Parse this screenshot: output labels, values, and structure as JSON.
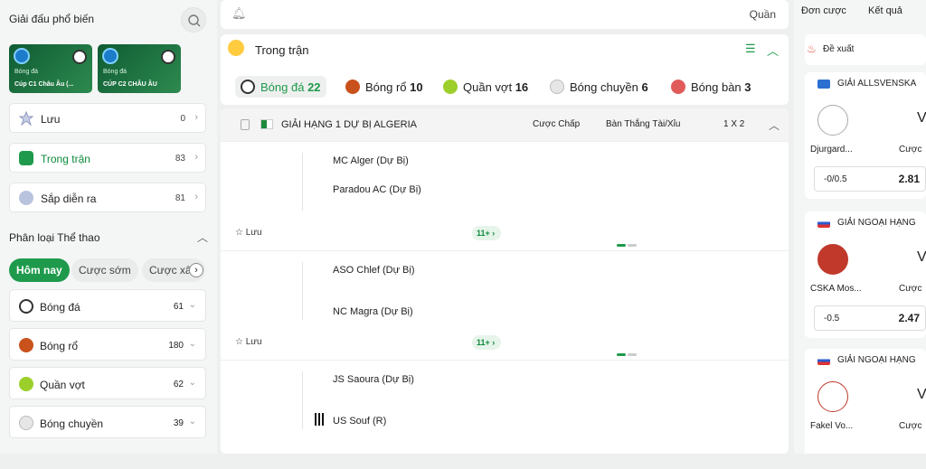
{
  "left": {
    "title": "Giải đấu phổ biến",
    "cards": [
      {
        "t1": "Bóng đá",
        "t2": "Cúp C1 Châu Âu (..."
      },
      {
        "t1": "Bóng đá",
        "t2": "CÚP C2 CHÂU ÂU"
      }
    ],
    "menu": [
      {
        "label": "Lưu",
        "count": "0"
      },
      {
        "label": "Trong trận",
        "count": "83"
      },
      {
        "label": "Sắp diễn ra",
        "count": "81"
      }
    ],
    "section": "Phân loại Thể thao",
    "tabs": [
      "Hôm nay",
      "Cược sớm",
      "Cược xâ"
    ],
    "sports": [
      {
        "label": "Bóng đá",
        "count": "61"
      },
      {
        "label": "Bóng rổ",
        "count": "180"
      },
      {
        "label": "Quần vợt",
        "count": "62"
      },
      {
        "label": "Bóng chuyền",
        "count": "39"
      }
    ]
  },
  "mid": {
    "topbar_right": "Quần",
    "live_title": "Trong trận",
    "sport_tabs": [
      {
        "label": "Bóng đá",
        "count": "22"
      },
      {
        "label": "Bóng rổ",
        "count": "10"
      },
      {
        "label": "Quần vợt",
        "count": "16"
      },
      {
        "label": "Bóng chuyền",
        "count": "6"
      },
      {
        "label": "Bóng bàn",
        "count": "3"
      }
    ],
    "league": {
      "name": "GIẢI HẠNG 1 DỰ BỊ ALGERIA",
      "col1": "Cược Chấp",
      "col2": "Bàn Thắng Tài/Xỉu",
      "col3": "1 X 2"
    },
    "matches": [
      {
        "home": "MC Alger (Dự Bị)",
        "away": "Paradou AC (Dự Bị)",
        "save": "Lưu",
        "more": "11+ ›"
      },
      {
        "home": "ASO Chlef (Dự Bị)",
        "away": "NC Magra (Dự Bị)",
        "save": "Lưu",
        "more": "11+ ›"
      },
      {
        "home": "JS Saoura (Dự Bị)",
        "away": "US Souf (R)",
        "save": "",
        "more": ""
      }
    ]
  },
  "right": {
    "tabs": [
      "Đơn cược",
      "Kết quả"
    ],
    "suggest": "Đề xuất",
    "cards": [
      {
        "league": "GIẢI ALLSVENSKA",
        "team": "Djurgard...",
        "cuoc": "Cược",
        "handicap": "-0/0.5",
        "odd": "2.81"
      },
      {
        "league": "GIẢI NGOẠI HẠNG",
        "team": "CSKA Mos...",
        "cuoc": "Cược",
        "handicap": "-0.5",
        "odd": "2.47"
      },
      {
        "league": "GIẢI NGOẠI HẠNG",
        "team": "Fakel Vo...",
        "cuoc": "Cược",
        "handicap": "",
        "odd": ""
      }
    ]
  }
}
